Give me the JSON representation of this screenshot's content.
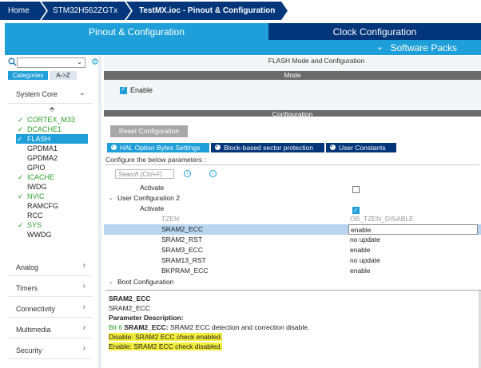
{
  "breadcrumb": {
    "home": "Home",
    "mcu": "STM32H562ZGTx",
    "file": "TestMX.ioc - Pinout & Configuration"
  },
  "tabs": {
    "pinout": "Pinout & Configuration",
    "clock": "Clock Configuration",
    "packs": "Software Packs",
    "packs_icon": "chevron-down-icon"
  },
  "left": {
    "categories": "Categories",
    "az": "A->Z",
    "system_core": "System Core",
    "peripherals": [
      {
        "label": "CORTEX_M33",
        "checked": true
      },
      {
        "label": "DCACHE1",
        "checked": true
      },
      {
        "label": "FLASH",
        "checked": true,
        "selected": true
      },
      {
        "label": "GPDMA1",
        "checked": false
      },
      {
        "label": "GPDMA2",
        "checked": false
      },
      {
        "label": "GPIO",
        "checked": false
      },
      {
        "label": "ICACHE",
        "checked": true
      },
      {
        "label": "IWDG",
        "checked": false
      },
      {
        "label": "NVIC",
        "checked": true
      },
      {
        "label": "RAMCFG",
        "checked": false
      },
      {
        "label": "RCC",
        "checked": false
      },
      {
        "label": "SYS",
        "checked": true
      },
      {
        "label": "WWDG",
        "checked": false
      }
    ],
    "groups": [
      "Analog",
      "Timers",
      "Connectivity",
      "Multimedia",
      "Security"
    ]
  },
  "right": {
    "title": "FLASH Mode and Configuration",
    "mode_header": "Mode",
    "enable_label": "Enable",
    "enable_checked": true,
    "config_header": "Configuration",
    "reset_button": "Reset Configuration",
    "subtabs": [
      "HAL Option Bytes Settings",
      "Block-based sector protection",
      "User Constants"
    ],
    "hint": "Configure the below parameters :",
    "search_placeholder": "Search (Ctrl+F)",
    "rows": {
      "activate1": "Activate",
      "user_cfg2": "User Configuration 2",
      "activate2": "Activate",
      "tzen": "TZEN",
      "tzen_val": "OB_TZEN_DISABLE",
      "sram2_ecc": "SRAM2_ECC",
      "sram2_ecc_val": "enable",
      "sram2_rst": "SRAM2_RST",
      "sram2_rst_val": "no update",
      "sram3_ecc": "SRAM3_ECC",
      "sram3_ecc_val": "enable",
      "sram13_rst": "SRAM13_RST",
      "sram13_rst_val": "no update",
      "bkpram_ecc": "BKPRAM_ECC",
      "bkpram_ecc_val": "enable",
      "boot_cfg": "Boot Configuration"
    },
    "description": {
      "line1": "SRAM2_ECC",
      "line2": "SRAM2_ECC",
      "param_desc": "Parameter Description:",
      "bit": "Bit 6",
      "bit_name": "SRAM2_ECC:",
      "bit_text": "SRAM2 ECC detection and correction disable.",
      "disable": "Disable: SRAM2 ECC check enabled.",
      "enable": "Enable: SRAM2 ECC check disabled."
    }
  }
}
